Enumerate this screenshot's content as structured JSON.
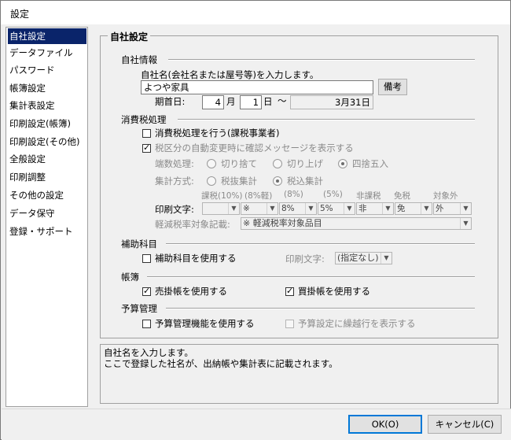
{
  "window": {
    "title": "設定"
  },
  "sidebar": {
    "items": [
      {
        "label": "自社設定",
        "selected": true
      },
      {
        "label": "データファイル"
      },
      {
        "label": "パスワード"
      },
      {
        "label": "帳簿設定"
      },
      {
        "label": "集計表設定"
      },
      {
        "label": "印刷設定(帳簿)"
      },
      {
        "label": "印刷設定(その他)"
      },
      {
        "label": "全般設定"
      },
      {
        "label": "印刷調整"
      },
      {
        "label": "その他の設定"
      },
      {
        "label": "データ保守"
      },
      {
        "label": "登録・サポート"
      }
    ]
  },
  "panel": {
    "title": "自社設定",
    "company": {
      "section": "自社情報",
      "name_label": "自社名(会社名または屋号等)を入力します。",
      "name_value": "よつや家具",
      "note_button": "備考",
      "start_label": "期首日:",
      "month_value": "4",
      "month_unit": "月",
      "day_value": "1",
      "day_unit": "日",
      "tilde": "〜",
      "end_value": "3月31日"
    },
    "tax": {
      "section": "消費税処理",
      "use_tax_label": "消費税処理を行う(課税事業者)",
      "use_tax_checked": false,
      "confirm_label": "税区分の自動変更時に確認メッセージを表示する",
      "confirm_checked": true,
      "rounding_label": "端数処理:",
      "rounding_options": [
        "切り捨て",
        "切り上げ",
        "四捨五入"
      ],
      "rounding_selected": "四捨五入",
      "method_label": "集計方式:",
      "method_options": [
        "税抜集計",
        "税込集計"
      ],
      "method_selected": "税込集計",
      "columns": [
        "課税(10%)",
        "(8%軽)",
        "(8%)",
        "(5%)",
        "非課税",
        "免税",
        "対象外"
      ],
      "print_label": "印刷文字:",
      "print_values": [
        "",
        "※",
        "8%",
        "5%",
        "非",
        "免",
        "外"
      ],
      "reduced_label": "軽減税率対象記載:",
      "reduced_value": "※ 軽減税率対象品目"
    },
    "aux": {
      "section": "補助科目",
      "use_label": "補助科目を使用する",
      "use_checked": false,
      "print_label": "印刷文字:",
      "print_value": "(指定なし)"
    },
    "ledger": {
      "section": "帳簿",
      "receivable_label": "売掛帳を使用する",
      "receivable_checked": true,
      "payable_label": "買掛帳を使用する",
      "payable_checked": true
    },
    "budget": {
      "section": "予算管理",
      "use_label": "予算管理機能を使用する",
      "use_checked": false,
      "carry_label": "予算設定に繰越行を表示する",
      "carry_checked": false
    }
  },
  "hint": {
    "line1": "自社名を入力します。",
    "line2": "ここで登録した社名が、出納帳や集計表に記載されます。"
  },
  "footer": {
    "ok_label": "OK(O)",
    "cancel_label": "キャンセル(C)"
  },
  "colors": {
    "selection": "#0a246a",
    "accent": "#0078d7"
  }
}
